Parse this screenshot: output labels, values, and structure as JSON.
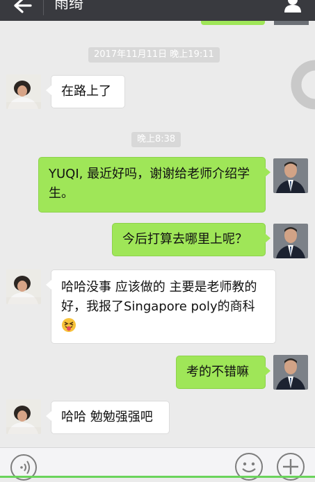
{
  "header": {
    "title": "雨绮"
  },
  "timestamps": {
    "first": "2017年11月11日 晚上19:11",
    "second": "晚上8:38"
  },
  "messages": {
    "m1": "在路上了",
    "m2": "YUQI, 最近好吗，谢谢给老师介绍学生。",
    "m3": "今后打算去哪里上呢？",
    "m4": "哈哈没事 应该做的 主要是老师教的好，我报了Singapore poly的商科",
    "m5": "考的不错嘛",
    "m6": "哈哈 勉勉强强吧"
  },
  "icons": {
    "back": "back-arrow-icon",
    "contact": "person-icon",
    "voice": "voice-icon",
    "emoji": "emoji-icon",
    "add": "plus-icon",
    "tongue_emoji": "tongue-out-emoji-icon"
  },
  "colors": {
    "header_bg": "#393a3f",
    "outgoing_bubble": "#9fe658",
    "incoming_bubble": "#ffffff",
    "chat_bg": "#ebebeb"
  }
}
